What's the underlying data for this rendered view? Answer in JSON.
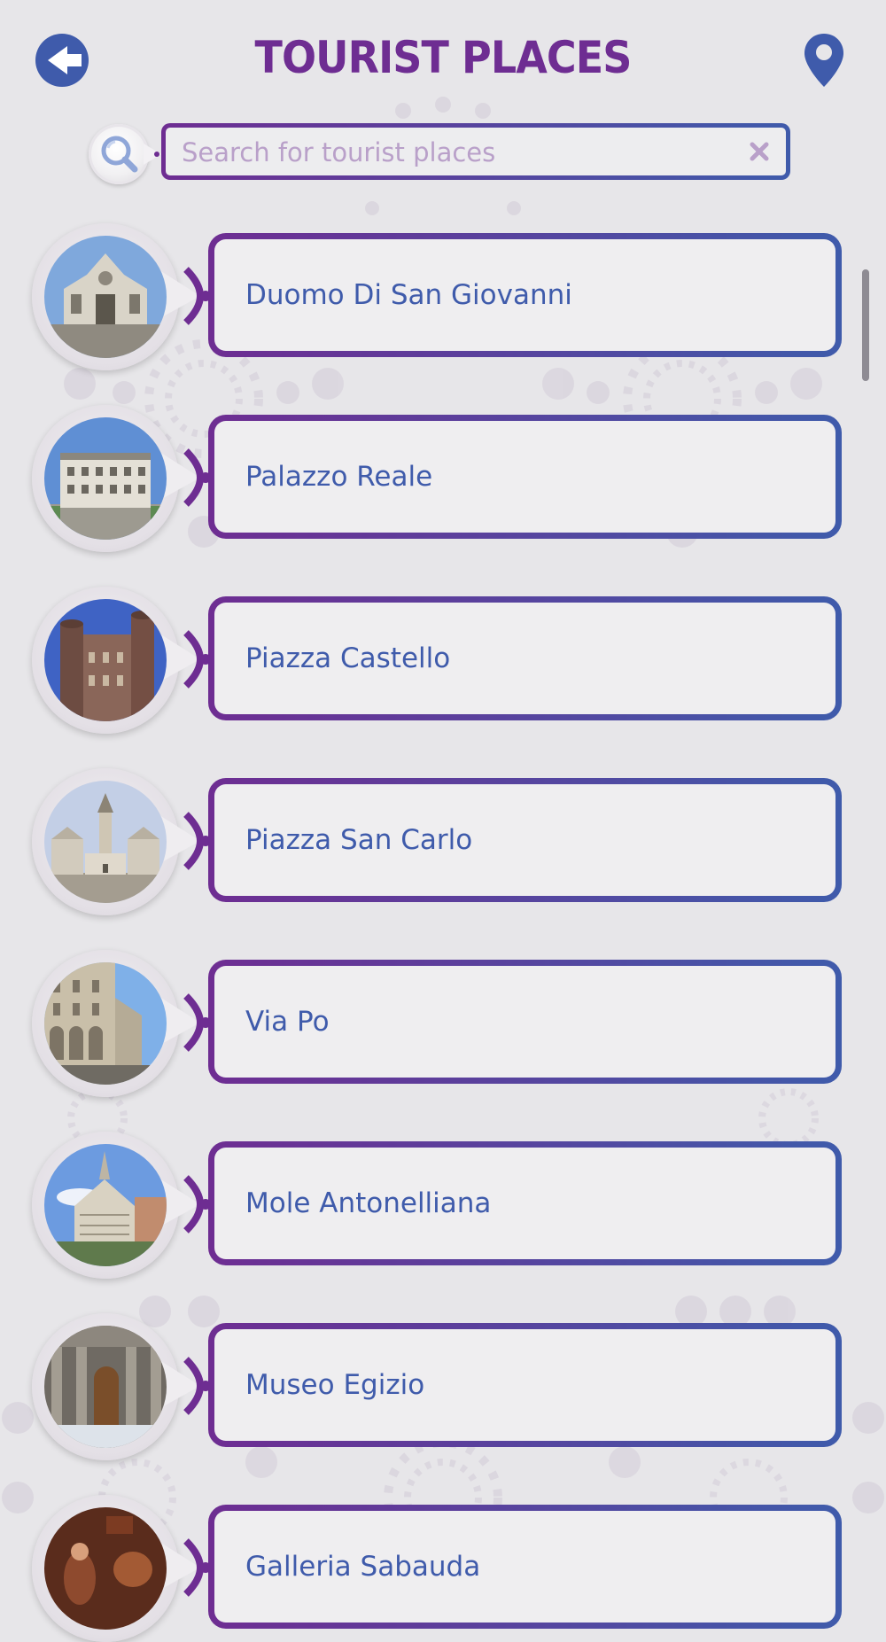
{
  "header": {
    "title": "TOURIST PLACES",
    "back_icon": "back-arrow-icon",
    "map_icon": "map-pin-icon"
  },
  "search": {
    "placeholder": "Search for tourist places",
    "value": "",
    "icon": "search-icon",
    "clear_icon": "close-icon"
  },
  "places": [
    {
      "name": "Duomo Di San Giovanni"
    },
    {
      "name": "Palazzo Reale"
    },
    {
      "name": "Piazza Castello"
    },
    {
      "name": "Piazza San Carlo"
    },
    {
      "name": "Via Po"
    },
    {
      "name": "Mole Antonelliana"
    },
    {
      "name": "Museo Egizio"
    },
    {
      "name": "Galleria Sabauda"
    }
  ],
  "colors": {
    "purple": "#6e2d92",
    "blue": "#3f5bab",
    "background": "#e7e6e9",
    "card": "#efeef0"
  }
}
